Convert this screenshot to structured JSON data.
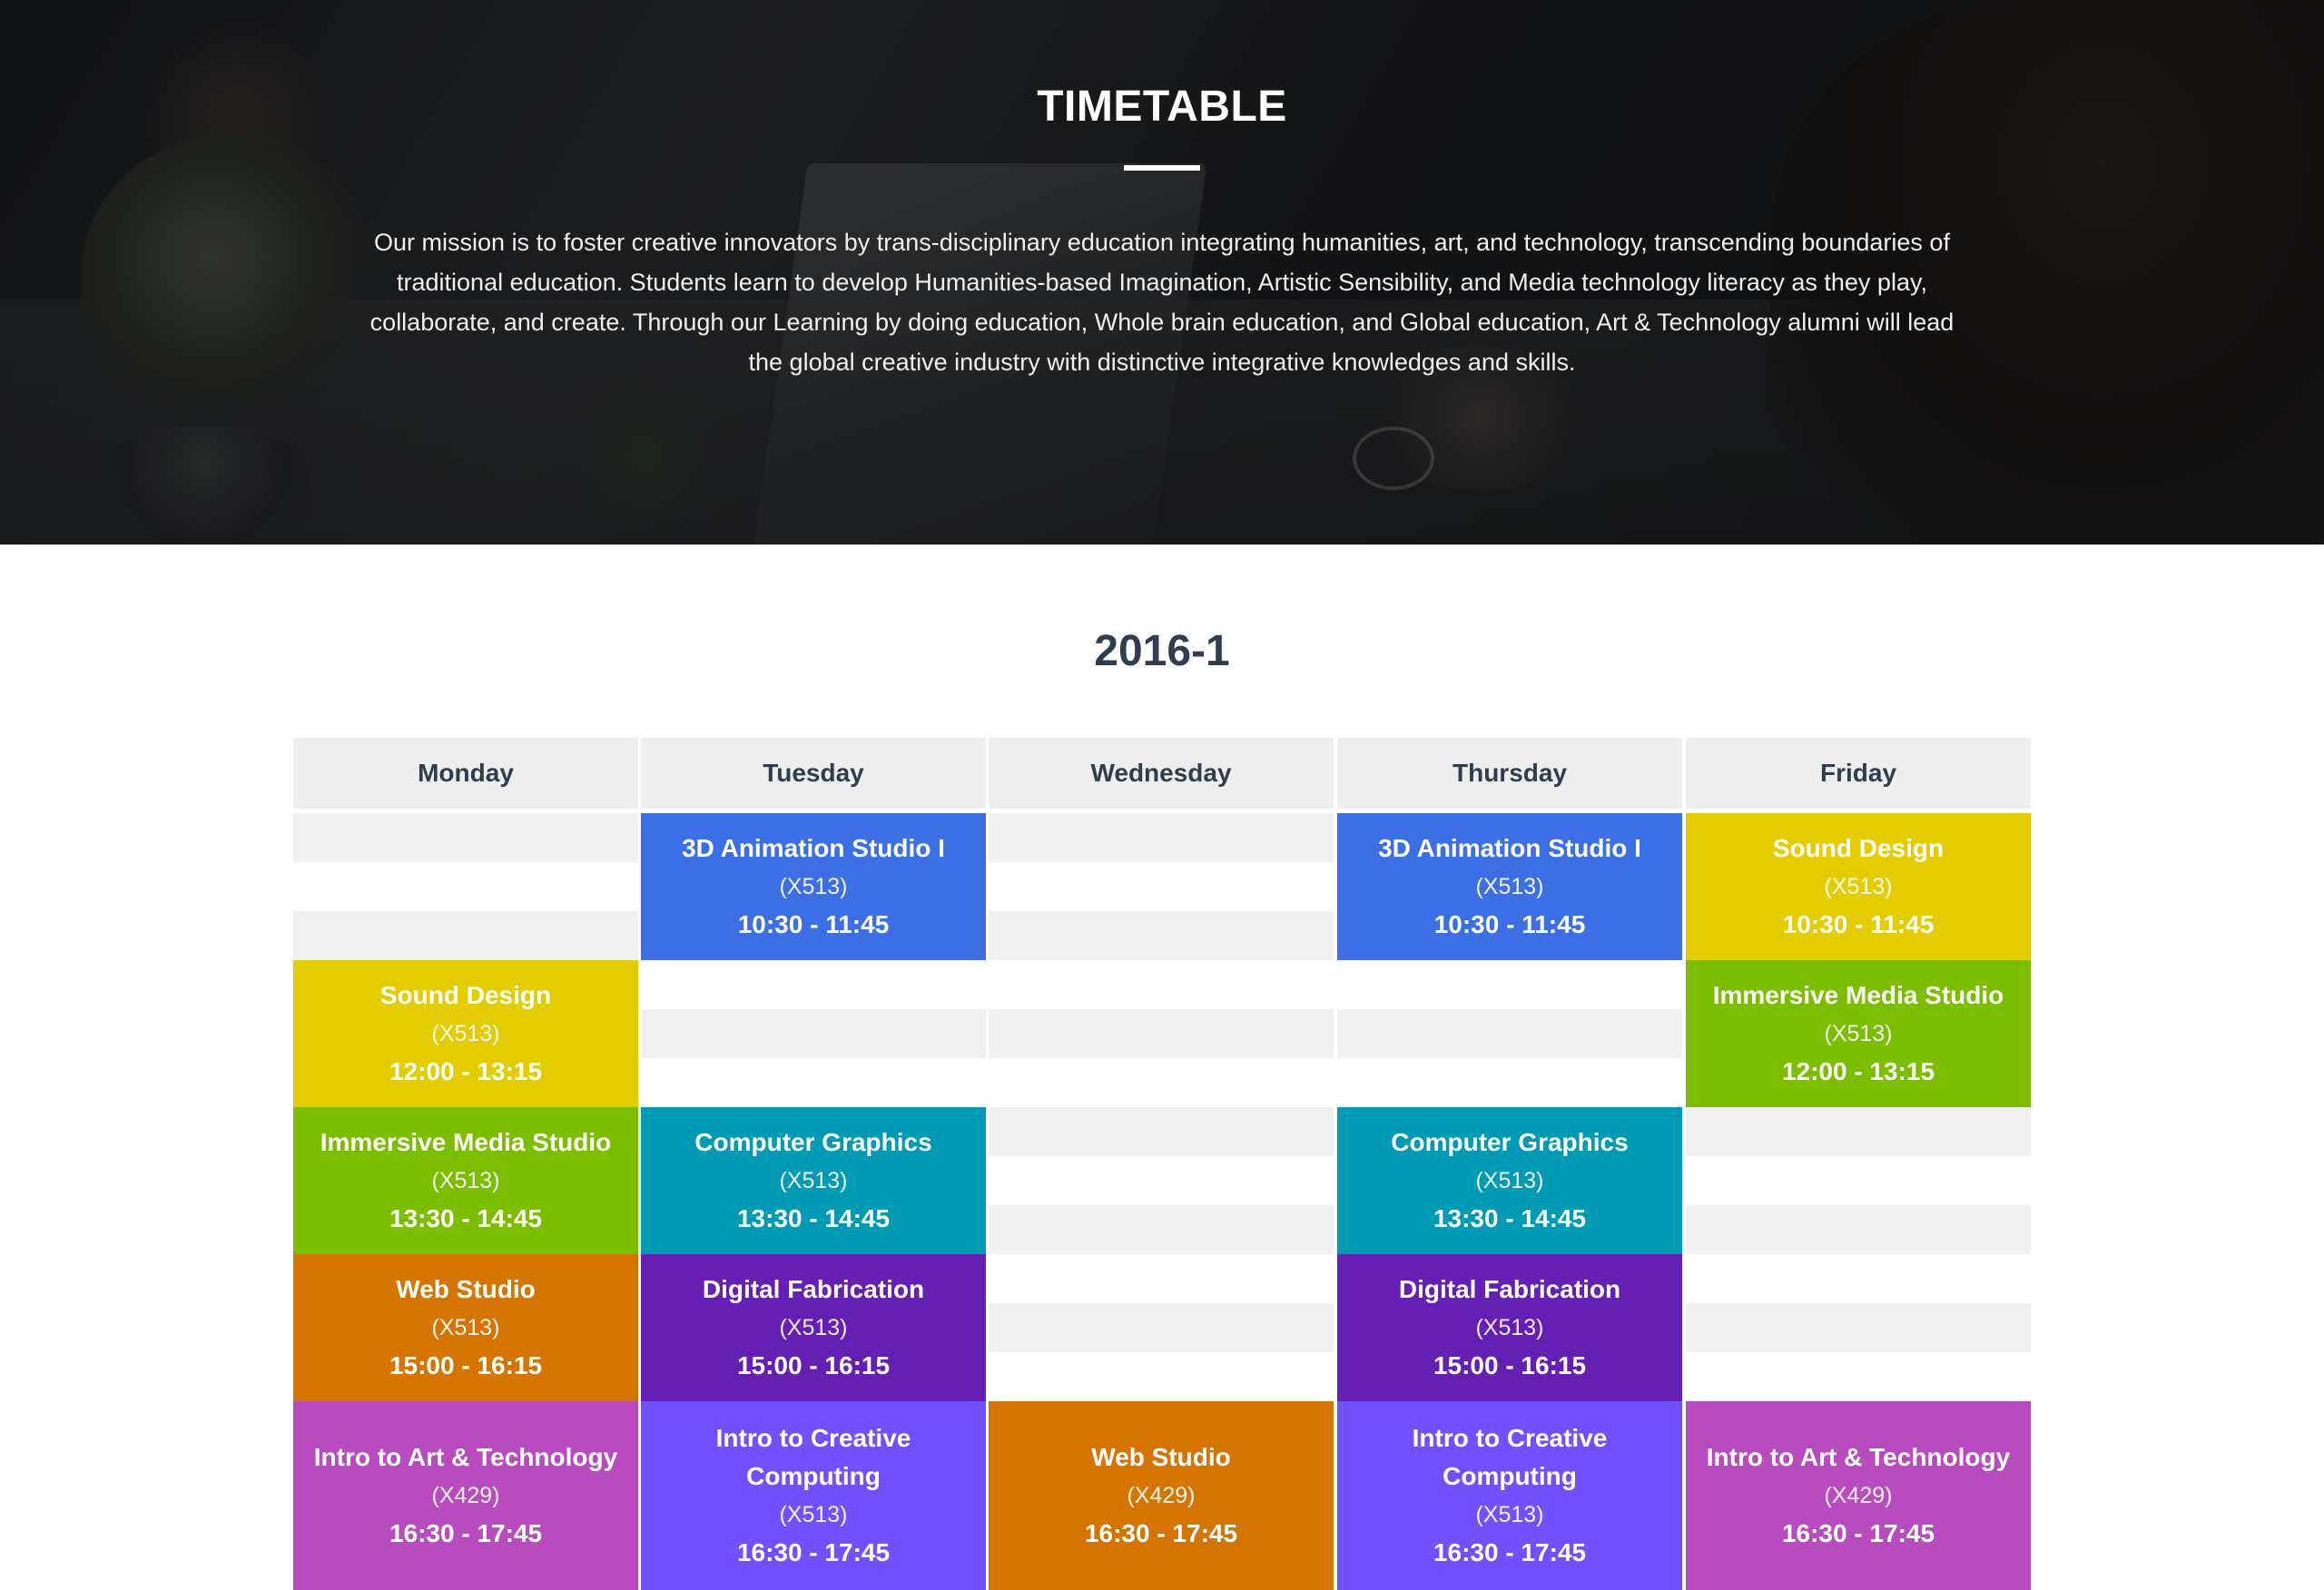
{
  "hero": {
    "title": "TIMETABLE",
    "mission": "Our mission is to foster creative innovators by trans-disciplinary education integrating humanities, art, and technology, transcending boundaries of traditional education. Students learn to develop Humanities-based Imagination, Artistic Sensibility, and Media technology literacy as they play, collaborate, and create. Through our Learning by doing education, Whole brain education, and Global education, Art & Technology alumni will lead the global creative industry with distinctive integrative knowledges and skills."
  },
  "timetable": {
    "semester": "2016-1",
    "days": [
      "Monday",
      "Tuesday",
      "Wednesday",
      "Thursday",
      "Friday"
    ],
    "colors": {
      "blue": "#3b6fe3",
      "yellow": "#e3cc00",
      "green": "#7cbd00",
      "teal": "#009ab5",
      "orange": "#d67400",
      "purple": "#651fb3",
      "violet": "#7150fd",
      "magenta": "#b84cbe"
    },
    "events": {
      "mon": [
        {
          "name": "Sound Design",
          "room": "(X513)",
          "time": "12:00 - 13:15"
        },
        {
          "name": "Immersive Media Studio",
          "room": "(X513)",
          "time": "13:30 - 14:45"
        },
        {
          "name": "Web Studio",
          "room": "(X513)",
          "time": "15:00 - 16:15"
        },
        {
          "name": "Intro to Art & Technology",
          "room": "(X429)",
          "time": "16:30 - 17:45"
        }
      ],
      "tue": [
        {
          "name": "3D Animation Studio I",
          "room": "(X513)",
          "time": "10:30 - 11:45"
        },
        {
          "name": "Computer Graphics",
          "room": "(X513)",
          "time": "13:30 - 14:45"
        },
        {
          "name": "Digital Fabrication",
          "room": "(X513)",
          "time": "15:00 - 16:15"
        },
        {
          "name": "Intro to Creative Computing",
          "room": "(X513)",
          "time": "16:30 - 17:45"
        }
      ],
      "wed": [
        {
          "name": "Web Studio",
          "room": "(X429)",
          "time": "16:30 - 17:45"
        }
      ],
      "thu": [
        {
          "name": "3D Animation Studio I",
          "room": "(X513)",
          "time": "10:30 - 11:45"
        },
        {
          "name": "Computer Graphics",
          "room": "(X513)",
          "time": "13:30 - 14:45"
        },
        {
          "name": "Digital Fabrication",
          "room": "(X513)",
          "time": "15:00 - 16:15"
        },
        {
          "name": "Intro to Creative Computing",
          "room": "(X513)",
          "time": "16:30 - 17:45"
        }
      ],
      "fri": [
        {
          "name": "Sound Design",
          "room": "(X513)",
          "time": "10:30 - 11:45"
        },
        {
          "name": "Immersive Media Studio",
          "room": "(X513)",
          "time": "12:00 - 13:15"
        },
        {
          "name": "Intro to Art & Technology",
          "room": "(X429)",
          "time": "16:30 - 17:45"
        }
      ]
    }
  }
}
